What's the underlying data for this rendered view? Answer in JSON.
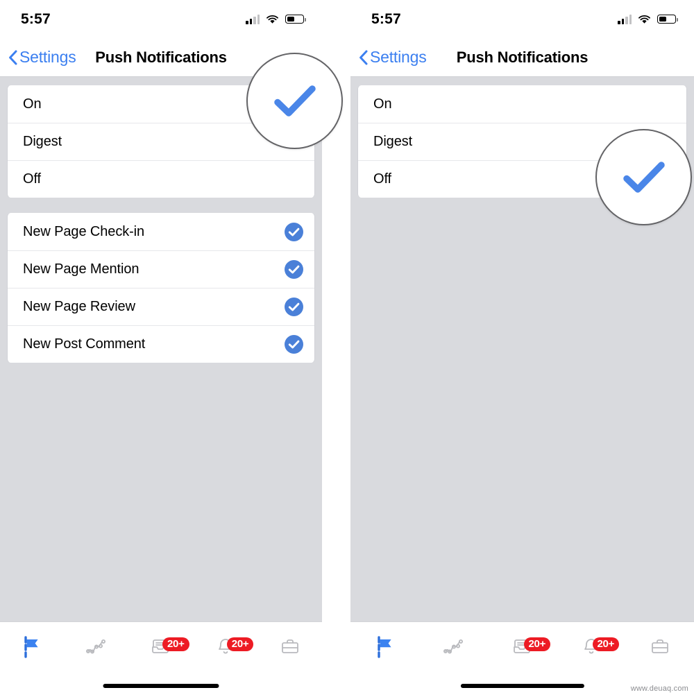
{
  "watermark": "www.deuaq.com",
  "panels": [
    {
      "id": "left",
      "status": {
        "time": "5:57",
        "signal_icon": "cellular-signal-icon",
        "wifi_icon": "wifi-icon",
        "battery_icon": "battery-icon"
      },
      "nav": {
        "back_label": "Settings",
        "back_icon": "chevron-left-icon",
        "title": "Push Notifications"
      },
      "frequency_group": [
        {
          "label": "On",
          "selected": true
        },
        {
          "label": "Digest",
          "selected": false
        },
        {
          "label": "Off",
          "selected": false
        }
      ],
      "types_group": [
        {
          "label": "New Page Check-in",
          "checked": true
        },
        {
          "label": "New Page Mention",
          "checked": true
        },
        {
          "label": "New Page Review",
          "checked": true
        },
        {
          "label": "New Post Comment",
          "checked": true
        }
      ],
      "magnifier": {
        "target_row": "On",
        "icon": "checkmark-icon"
      },
      "tabs": [
        {
          "name": "pages",
          "icon": "flag-icon",
          "active": true,
          "badge": ""
        },
        {
          "name": "insights",
          "icon": "insights-icon",
          "active": false,
          "badge": ""
        },
        {
          "name": "inbox",
          "icon": "inbox-icon",
          "active": false,
          "badge": "20+"
        },
        {
          "name": "notifications",
          "icon": "bell-icon",
          "active": false,
          "badge": "20+"
        },
        {
          "name": "business",
          "icon": "briefcase-icon",
          "active": false,
          "badge": ""
        }
      ]
    },
    {
      "id": "right",
      "status": {
        "time": "5:57",
        "signal_icon": "cellular-signal-icon",
        "wifi_icon": "wifi-icon",
        "battery_icon": "battery-icon"
      },
      "nav": {
        "back_label": "Settings",
        "back_icon": "chevron-left-icon",
        "title": "Push Notifications"
      },
      "frequency_group": [
        {
          "label": "On",
          "selected": false
        },
        {
          "label": "Digest",
          "selected": false
        },
        {
          "label": "Off",
          "selected": true
        }
      ],
      "types_group": [],
      "magnifier": {
        "target_row": "Off",
        "icon": "checkmark-icon"
      },
      "tabs": [
        {
          "name": "pages",
          "icon": "flag-icon",
          "active": true,
          "badge": ""
        },
        {
          "name": "insights",
          "icon": "insights-icon",
          "active": false,
          "badge": ""
        },
        {
          "name": "inbox",
          "icon": "inbox-icon",
          "active": false,
          "badge": "20+"
        },
        {
          "name": "notifications",
          "icon": "bell-icon",
          "active": false,
          "badge": "20+"
        },
        {
          "name": "business",
          "icon": "briefcase-icon",
          "active": false,
          "badge": ""
        }
      ]
    }
  ],
  "colors": {
    "accent_blue": "#3b7ff0",
    "check_blue": "#4a80d8",
    "badge_red": "#ed1b24",
    "page_bg": "#d9dade",
    "card_bg": "#ffffff",
    "separator": "#e6e7ea"
  }
}
